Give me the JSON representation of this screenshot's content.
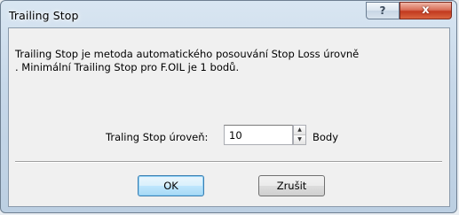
{
  "window": {
    "title": "Trailing Stop",
    "help_glyph": "?",
    "close_glyph": "x"
  },
  "message": {
    "line1": "Trailing Stop je metoda automatického posouvání Stop Loss úrovně",
    "line2": ". Minimální Trailing Stop pro F.OIL je 1 bodů."
  },
  "level_field": {
    "label": "Traling Stop úroveň:",
    "value": "10",
    "unit": "Body",
    "spin_up_glyph": "▲",
    "spin_down_glyph": "▼"
  },
  "buttons": {
    "ok": "OK",
    "cancel": "Zrušit"
  }
}
